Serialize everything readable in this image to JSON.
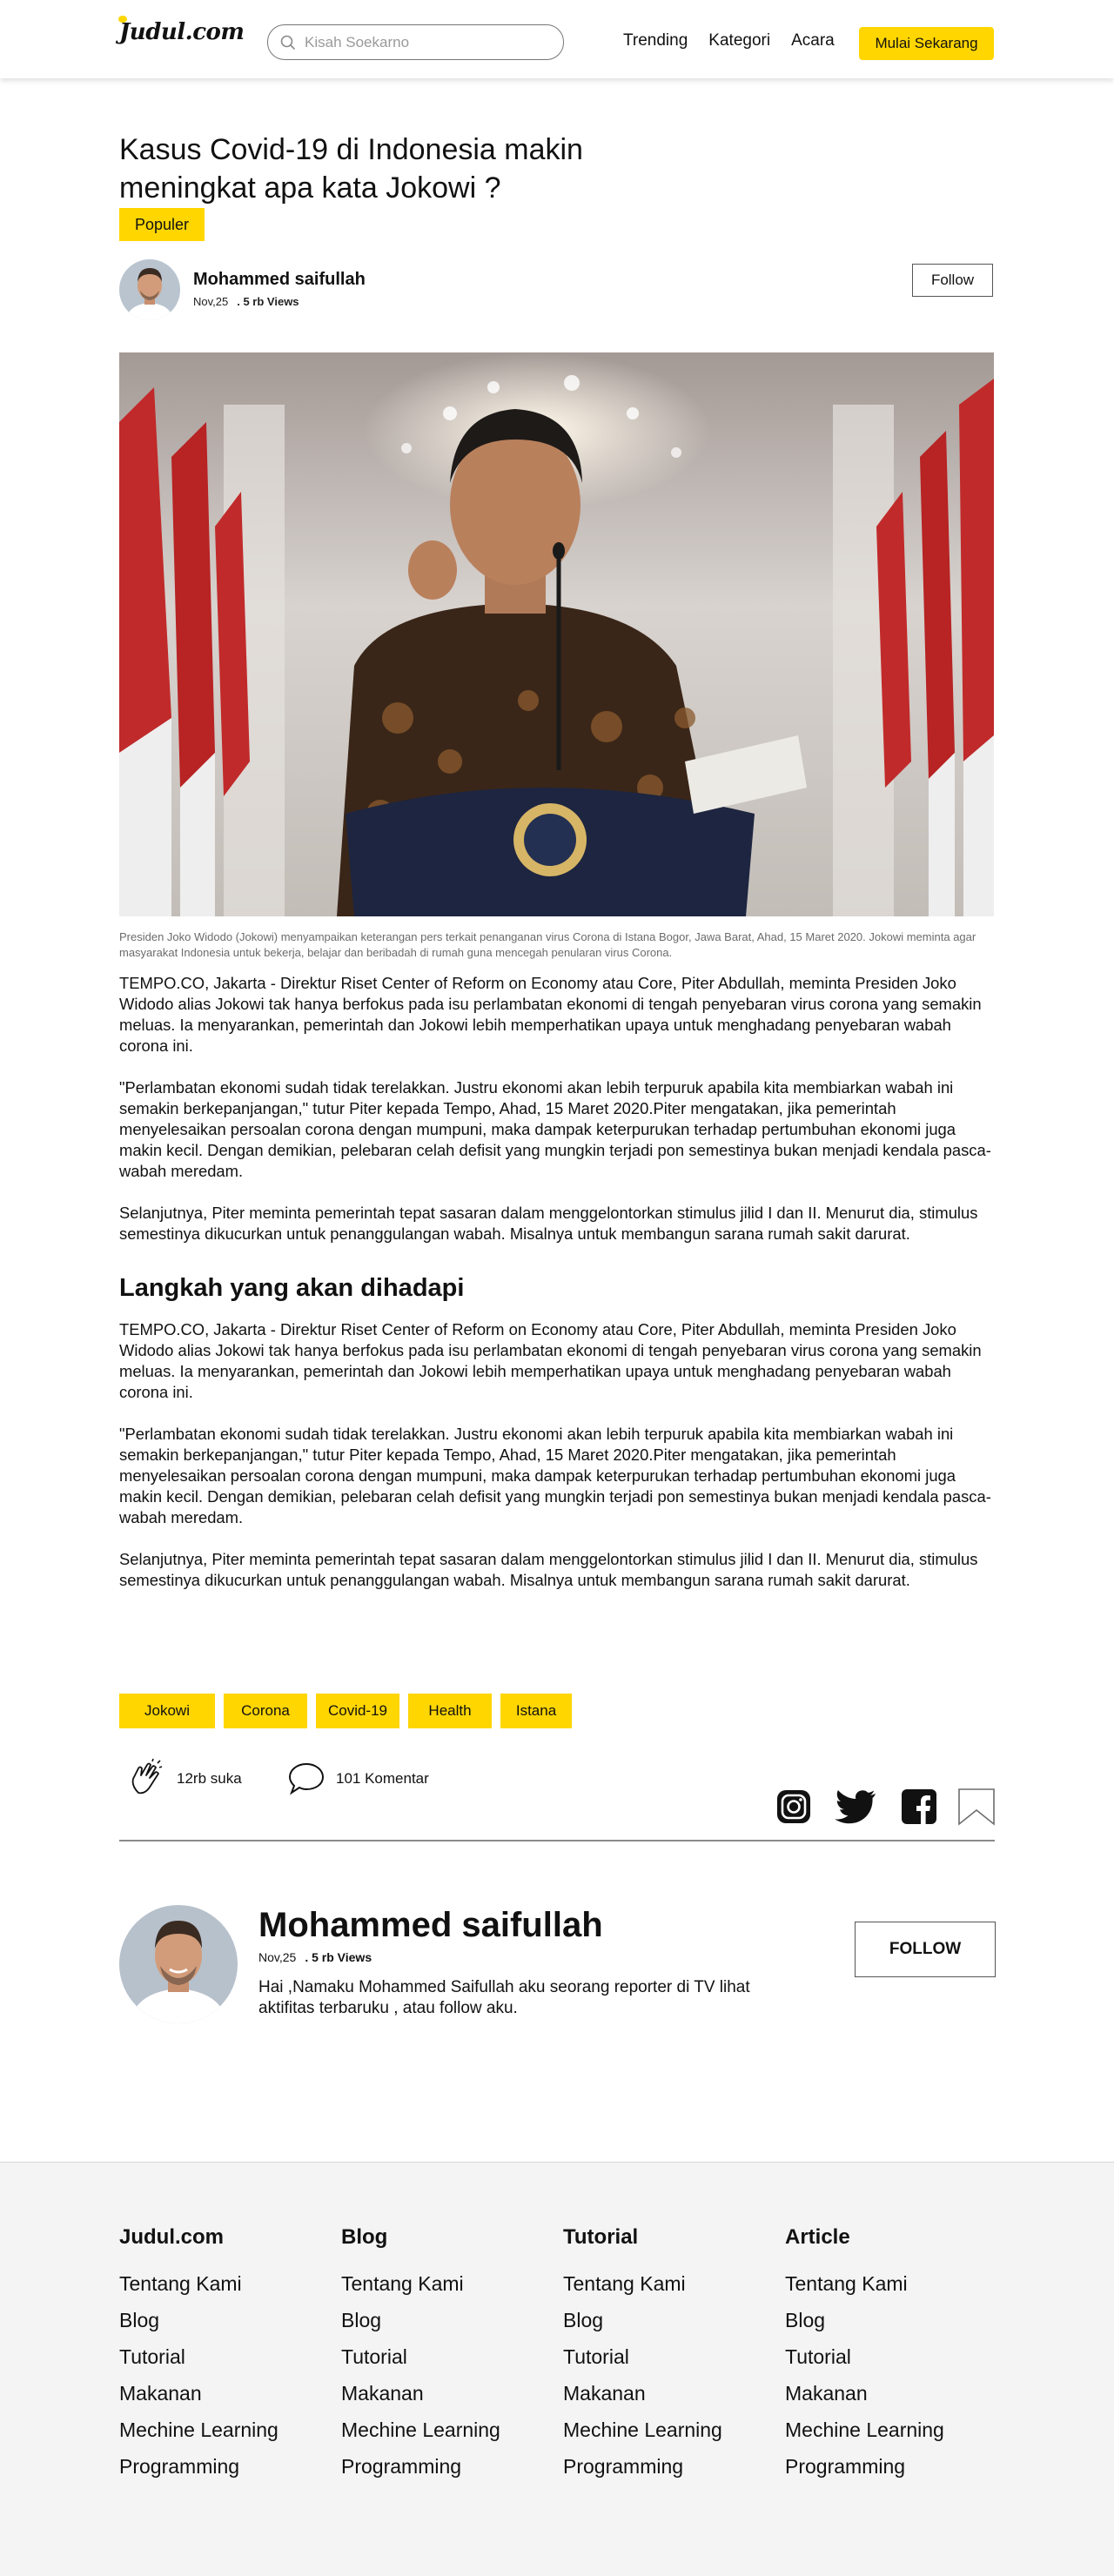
{
  "header": {
    "logo": "Judul.com",
    "search_placeholder": "Kisah Soekarno",
    "nav": [
      "Trending",
      "Kategori",
      "Acara"
    ],
    "cta_label": "Mulai Sekarang"
  },
  "article": {
    "title": "Kasus Covid-19 di Indonesia makin meningkat apa kata Jokowi ?",
    "badge": "Populer",
    "author": {
      "name": "Mohammed saifullah",
      "date": "Nov,25",
      "views": ". 5 rb Views",
      "follow_label": "Follow"
    },
    "image_caption": "Presiden Joko Widodo (Jokowi) menyampaikan keterangan pers terkait penanganan virus Corona di Istana Bogor, Jawa Barat, Ahad, 15 Maret 2020. Jokowi meminta agar masyarakat Indonesia untuk bekerja, belajar dan beribadah di rumah guna mencegah penularan virus Corona.",
    "paragraphs": [
      "TEMPO.CO, Jakarta - Direktur Riset Center of Reform on Economy atau Core, Piter Abdullah, meminta Presiden Joko Widodo alias Jokowi tak hanya berfokus pada isu perlambatan ekonomi di tengah penyebaran virus corona yang semakin meluas. Ia menyarankan, pemerintah dan Jokowi lebih memperhatikan upaya untuk menghadang penyebaran wabah corona ini.",
      "\"Perlambatan ekonomi sudah tidak terelakkan. Justru ekonomi akan lebih terpuruk apabila kita membiarkan wabah ini semakin berkepanjangan,\" tutur Piter kepada Tempo, Ahad, 15 Maret 2020.Piter mengatakan, jika pemerintah menyelesaikan persoalan corona dengan mumpuni, maka dampak keterpurukan terhadap pertumbuhan ekonomi juga makin kecil. Dengan demikian, pelebaran celah defisit yang mungkin terjadi pon semestinya bukan menjadi kendala pasca-wabah meredam.",
      "Selanjutnya, Piter meminta pemerintah tepat sasaran dalam menggelontorkan stimulus jilid I dan II. Menurut dia, stimulus semestinya dikucurkan untuk penanggulangan wabah. Misalnya untuk membangun sarana rumah sakit darurat."
    ],
    "subheading": "Langkah yang akan dihadapi",
    "paragraphs_2": [
      "TEMPO.CO, Jakarta - Direktur Riset Center of Reform on Economy atau Core, Piter Abdullah, meminta Presiden Joko Widodo alias Jokowi tak hanya berfokus pada isu perlambatan ekonomi di tengah penyebaran virus corona yang semakin meluas. Ia menyarankan, pemerintah dan Jokowi lebih memperhatikan upaya untuk menghadang penyebaran wabah corona ini.",
      "\"Perlambatan ekonomi sudah tidak terelakkan. Justru ekonomi akan lebih terpuruk apabila kita membiarkan wabah ini semakin berkepanjangan,\" tutur Piter kepada Tempo, Ahad, 15 Maret 2020.Piter mengatakan, jika pemerintah menyelesaikan persoalan corona dengan mumpuni, maka dampak keterpurukan terhadap pertumbuhan ekonomi juga makin kecil. Dengan demikian, pelebaran celah defisit yang mungkin terjadi pon semestinya bukan menjadi kendala pasca-wabah meredam.",
      "Selanjutnya, Piter meminta pemerintah tepat sasaran dalam menggelontorkan stimulus jilid I dan II. Menurut dia, stimulus semestinya dikucurkan untuk penanggulangan wabah. Misalnya untuk membangun sarana rumah sakit darurat."
    ],
    "tags": [
      "Jokowi",
      "Corona",
      "Covid-19",
      "Health",
      "Istana"
    ],
    "likes": "12rb suka",
    "comments": "101 Komentar",
    "share_icons": [
      "instagram-icon",
      "twitter-icon",
      "facebook-icon",
      "bookmark-icon"
    ]
  },
  "author_card": {
    "name": "Mohammed saifullah",
    "date": "Nov,25",
    "views": ". 5 rb Views",
    "bio": "Hai ,Namaku Mohammed Saifullah aku seorang reporter di TV lihat aktifitas terbaruku , atau follow aku.",
    "follow_label": "FOLLOW"
  },
  "footer": {
    "columns": [
      {
        "title": "Judul.com",
        "links": [
          "Tentang Kami",
          "Blog",
          "Tutorial",
          "Makanan",
          "Mechine Learning",
          "Programming"
        ]
      },
      {
        "title": "Blog",
        "links": [
          "Tentang Kami",
          "Blog",
          "Tutorial",
          "Makanan",
          "Mechine Learning",
          "Programming"
        ]
      },
      {
        "title": "Tutorial",
        "links": [
          "Tentang Kami",
          "Blog",
          "Tutorial",
          "Makanan",
          "Mechine Learning",
          "Programming"
        ]
      },
      {
        "title": "Article",
        "links": [
          "Tentang Kami",
          "Blog",
          "Tutorial",
          "Makanan",
          "Mechine Learning",
          "Programming"
        ]
      }
    ]
  },
  "colors": {
    "accent": "#FFD600",
    "footer_bg": "#F4F4F4",
    "text": "#111111"
  }
}
